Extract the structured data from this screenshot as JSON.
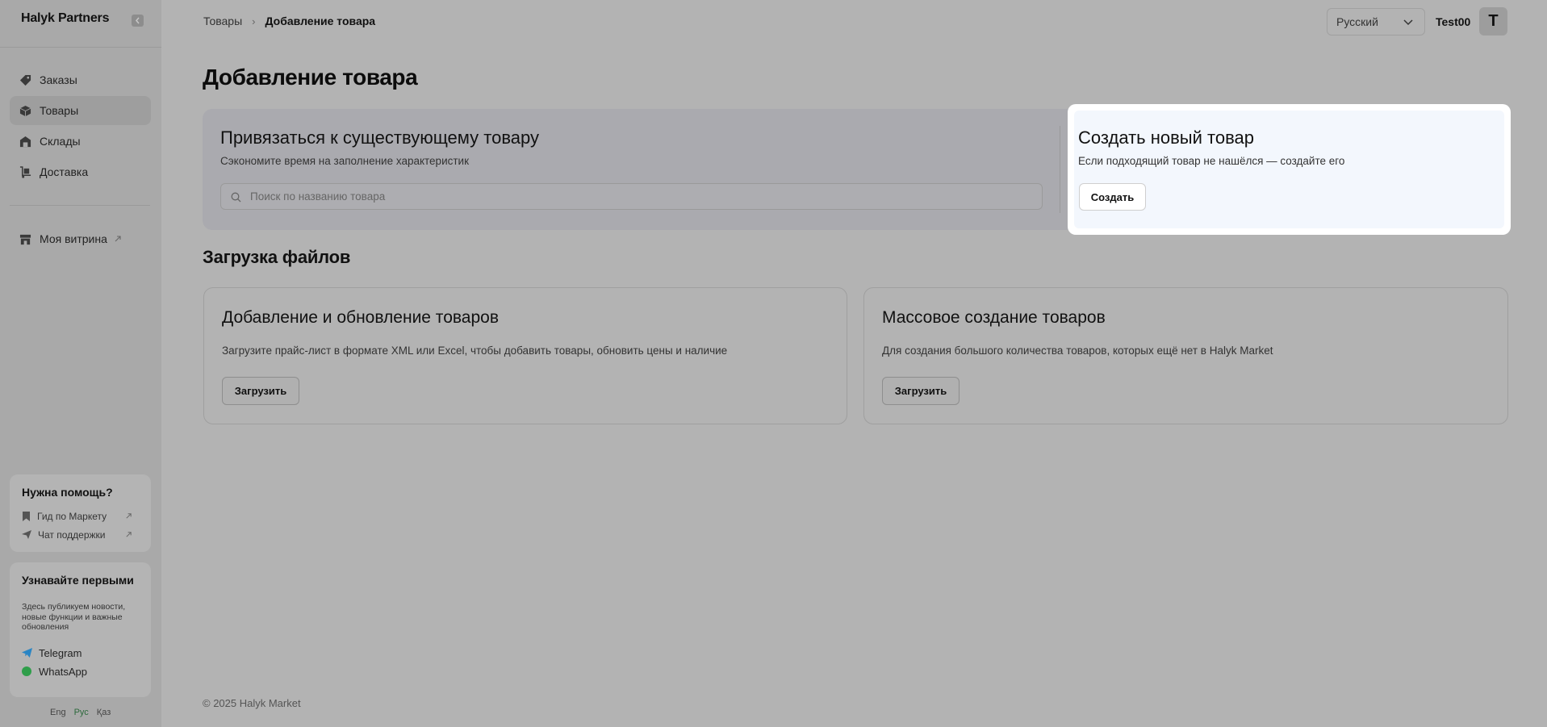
{
  "sidebar": {
    "logo": "Halyk Partners",
    "nav": [
      {
        "label": "Заказы",
        "icon": "tag-icon"
      },
      {
        "label": "Товары",
        "icon": "box-icon",
        "active": true
      },
      {
        "label": "Склады",
        "icon": "warehouse-icon"
      },
      {
        "label": "Доставка",
        "icon": "delivery-icon"
      }
    ],
    "storefront": {
      "label": "Моя витрина",
      "icon": "store-icon"
    },
    "help": {
      "title": "Нужна помощь?",
      "links": [
        {
          "label": "Гид по Маркету",
          "icon": "bookmark-icon"
        },
        {
          "label": "Чат поддержки",
          "icon": "send-icon"
        }
      ]
    },
    "news": {
      "title": "Узнавайте первыми",
      "text": "Здесь публикуем новости, новые функции и важные обновления",
      "links": [
        {
          "label": "Telegram",
          "icon": "telegram-icon"
        },
        {
          "label": "WhatsApp",
          "icon": "whatsapp-icon"
        }
      ]
    },
    "languages": [
      "Eng",
      "Рус",
      "Қаз"
    ],
    "active_language": "Рус"
  },
  "header": {
    "breadcrumb": [
      "Товары",
      "Добавление товара"
    ],
    "language": "Русский",
    "username": "Test00",
    "avatar_letter": "T"
  },
  "main": {
    "title": "Добавление товара",
    "bind": {
      "title": "Привязаться к существующему товару",
      "subtitle": "Сэкономите время на заполнение характеристик",
      "search_placeholder": "Поиск по названию товара"
    },
    "create": {
      "title": "Создать новый товар",
      "subtitle": "Если подходящий товар не нашёлся — создайте его",
      "button": "Создать"
    },
    "uploads_title": "Загрузка файлов",
    "uploads": [
      {
        "title": "Добавление и обновление товаров",
        "description": "Загрузите прайс-лист в формате XML или Excel, чтобы добавить товары, обновить цены и наличие",
        "button": "Загрузить"
      },
      {
        "title": "Массовое создание товаров",
        "description": "Для создания большого количества товаров, которых ещё нет в Halyk Market",
        "button": "Загрузить"
      }
    ],
    "footer": "© 2025 Halyk Market"
  },
  "colors": {
    "overlay_gray": "#b3b3b3",
    "highlight_panel": "#f3f7fd",
    "active_lang": "#2e6a3d",
    "telegram": "#2a85c4",
    "whatsapp": "#2f9e4a"
  }
}
